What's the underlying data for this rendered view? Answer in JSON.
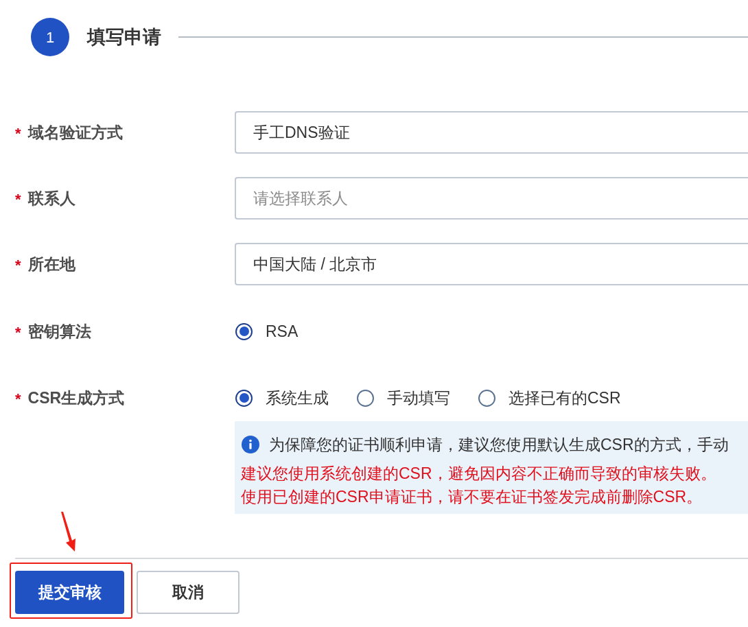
{
  "step": {
    "number": "1",
    "title": "填写申请"
  },
  "fields": [
    {
      "kind": "input",
      "marker": "*",
      "label": "域名验证方式",
      "value": "手工DNS验证"
    },
    {
      "kind": "input",
      "marker": "*",
      "label": "联系人",
      "placeholder": "请选择联系人"
    },
    {
      "kind": "input",
      "marker": "*",
      "label": "所在地",
      "value": "中国大陆 / 北京市"
    },
    {
      "kind": "radio",
      "marker": "*",
      "label": "密钥算法",
      "options": [
        {
          "label": "RSA",
          "selected": true
        }
      ]
    },
    {
      "kind": "radio",
      "marker": "*",
      "label": "CSR生成方式",
      "options": [
        {
          "label": "系统生成",
          "selected": true
        },
        {
          "label": "手动填写",
          "selected": false
        },
        {
          "label": "选择已有的CSR",
          "selected": false
        }
      ],
      "notice": {
        "info": "为保障您的证书顺利申请，建议您使用默认生成CSR的方式，手动",
        "warnings": [
          "建议您使用系统创建的CSR，避免因内容不正确而导致的审核失败。",
          "使用已创建的CSR申请证书，请不要在证书签发完成前删除CSR。"
        ]
      }
    }
  ],
  "buttons": [
    {
      "kind": "primary",
      "label": "提交审核",
      "highlighted": true
    },
    {
      "kind": "default",
      "label": "取消",
      "highlighted": false
    }
  ]
}
